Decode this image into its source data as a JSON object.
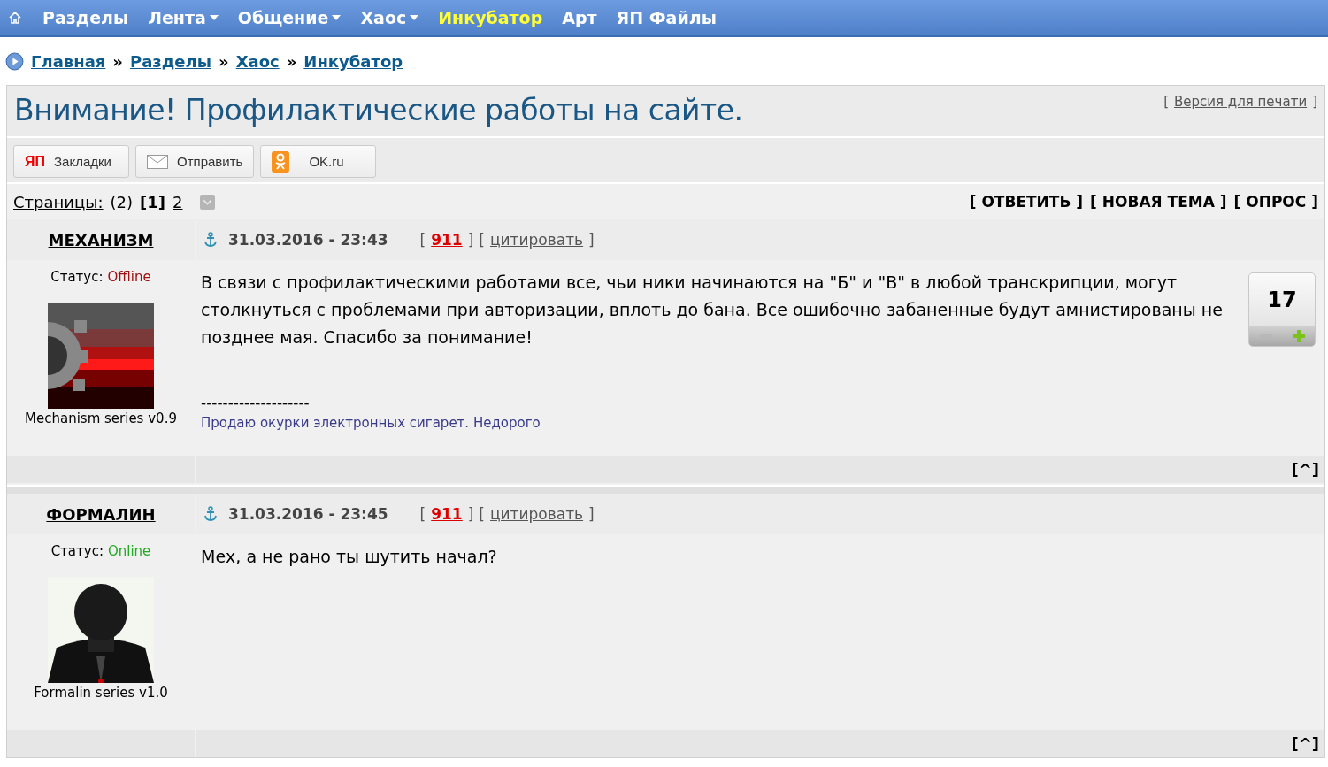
{
  "nav": {
    "items": [
      {
        "label": "Разделы",
        "dropdown": false,
        "selected": false
      },
      {
        "label": "Лента",
        "dropdown": true,
        "selected": false
      },
      {
        "label": "Общение",
        "dropdown": true,
        "selected": false
      },
      {
        "label": "Хаос",
        "dropdown": true,
        "selected": false
      },
      {
        "label": "Инкубатор",
        "dropdown": false,
        "selected": true
      },
      {
        "label": "Арт",
        "dropdown": false,
        "selected": false
      },
      {
        "label": "ЯП Файлы",
        "dropdown": false,
        "selected": false
      }
    ]
  },
  "breadcrumb": {
    "items": [
      "Главная",
      "Разделы",
      "Хаос",
      "Инкубатор"
    ],
    "separator": "»"
  },
  "topic": {
    "title": "Внимание! Профилактические работы на сайте.",
    "print": {
      "open": "[",
      "label": "Версия для печати",
      "close": "]"
    }
  },
  "share_buttons": [
    {
      "kind": "yap",
      "icon_text": "ЯП",
      "label": "Закладки"
    },
    {
      "kind": "mail",
      "label": "Отправить"
    },
    {
      "kind": "ok",
      "label": "OK.ru"
    }
  ],
  "pages": {
    "label": "Страницы:",
    "count": "(2)",
    "items": [
      {
        "label": "1",
        "selected": true,
        "open": "[",
        "close": "]"
      },
      {
        "label": "2",
        "selected": false
      }
    ]
  },
  "actions": [
    "[ ОТВЕТИТЬ ]",
    "[ НОВАЯ ТЕМА ]",
    "[ ОПРОС ]"
  ],
  "posts": [
    {
      "author": "МЕХАНИЗМ",
      "status_label": "Статус:",
      "status": "Offline",
      "online": false,
      "caption": "Mechanism series v0.9",
      "datetime": "31.03.2016 - 23:43",
      "rating": {
        "open": "[",
        "value": "911",
        "close": "]"
      },
      "quote": {
        "open": "[",
        "label": "цитировать",
        "close": "]"
      },
      "body": "В связи с профилактическими работами все, чьи ники начинаются на \"Б\" и \"В\" в любой транскрипции, могут столкнуться с проблемами при авторизации, вплоть до бана. Все ошибочно забаненные будут амнистированы не позднее мая. Спасибо за понимание!",
      "signature_rule": "--------------------",
      "signature": "Продаю окурки электронных сигарет. Недорого",
      "votes": "17",
      "top_link": "[^]"
    },
    {
      "author": "ФОРМАЛИН",
      "status_label": "Статус:",
      "status": "Online",
      "online": true,
      "caption": "Formalin series v1.0",
      "datetime": "31.03.2016 - 23:45",
      "rating": {
        "open": "[",
        "value": "911",
        "close": "]"
      },
      "quote": {
        "open": "[",
        "label": "цитировать",
        "close": "]"
      },
      "body": "Мех, а не рано ты шутить начал?",
      "top_link": "[^]"
    }
  ]
}
